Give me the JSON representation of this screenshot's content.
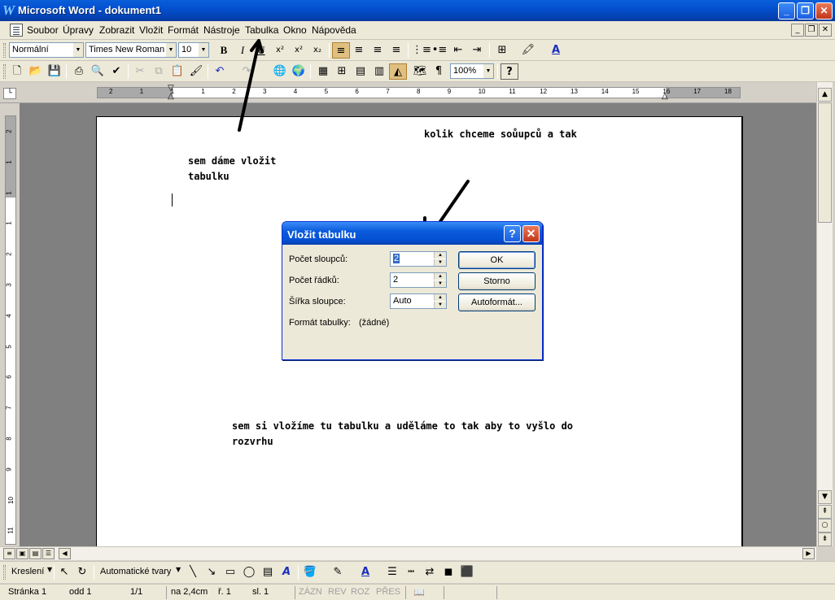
{
  "window": {
    "title": "Microsoft Word - dokument1",
    "app_icon": "W",
    "controls": {
      "minimize": "_",
      "restore": "❐",
      "close": "✕"
    }
  },
  "menu": {
    "items": [
      "Soubor",
      "Úpravy",
      "Zobrazit",
      "Vložit",
      "Formát",
      "Nástroje",
      "Tabulka",
      "Okno",
      "Nápověda"
    ],
    "mdi": {
      "minimize": "_",
      "restore": "❐",
      "close": "✕"
    }
  },
  "formatting": {
    "style": "Normální",
    "font": "Times New Roman",
    "size": "10",
    "bold": "B",
    "italic": "I",
    "underline": "U",
    "superscript": "x²",
    "subscript": "x₂",
    "sup2": "x²",
    "sub2": "x₂"
  },
  "standard": {
    "zoom": "100%",
    "help": "?"
  },
  "ruler": {
    "h_labels": [
      "2",
      "1",
      "1",
      "1",
      "2",
      "3",
      "4",
      "5",
      "6",
      "7",
      "8",
      "9",
      "10",
      "11",
      "12",
      "13",
      "14",
      "15",
      "16",
      "17",
      "18"
    ],
    "v_labels": [
      "2",
      "1",
      "1",
      "1",
      "2",
      "3",
      "4",
      "5",
      "6",
      "7",
      "8",
      "9",
      "10",
      "11"
    ]
  },
  "document": {
    "note1_line1": "sem dáme vložit",
    "note1_line2": "tabulku",
    "note2": "kolik chceme soůupců a tak",
    "note3_line1": "sem si vložíme tu tabulku a uděláme to tak aby to vyšlo do",
    "note3_line2": "rozvrhu"
  },
  "dialog": {
    "title": "Vložit tabulku",
    "help": "?",
    "close": "✕",
    "cols_label": "Počet sloupců:",
    "cols_value": "2",
    "rows_label": "Počet řádků:",
    "rows_value": "2",
    "width_label": "Šířka sloupce:",
    "width_value": "Auto",
    "format_label": "Formát tabulky:",
    "format_value": "(žádné)",
    "ok": "OK",
    "cancel": "Storno",
    "autoformat": "Autoformát..."
  },
  "drawing": {
    "draw_label": "Kreslení",
    "autoshapes_label": "Automatické tvary"
  },
  "status": {
    "page": "Stránka 1",
    "section": "odd 1",
    "pages": "1/1",
    "at": "na 2,4cm",
    "line": "ř. 1",
    "col": "sl. 1",
    "rec": "ZÁZN",
    "rev": "REV",
    "ext": "ROZ",
    "ovr": "PŘES"
  },
  "colors": {
    "titlebar": "#0450d0",
    "face": "#ece9d8",
    "workspace": "#808080"
  }
}
